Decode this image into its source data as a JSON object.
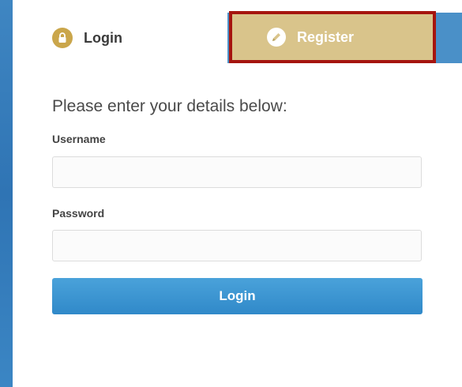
{
  "tabs": {
    "login": {
      "label": "Login",
      "icon": "lock-icon"
    },
    "register": {
      "label": "Register",
      "icon": "pencil-icon"
    }
  },
  "form": {
    "intro": "Please enter your details below:",
    "username": {
      "label": "Username",
      "value": "",
      "placeholder": ""
    },
    "password": {
      "label": "Password",
      "value": "",
      "placeholder": ""
    },
    "submit_label": "Login"
  },
  "colors": {
    "accent": "#3b8fd0",
    "lock": "#caa64b",
    "register_tab": "#d9c48b",
    "highlight": "#a5150f"
  }
}
